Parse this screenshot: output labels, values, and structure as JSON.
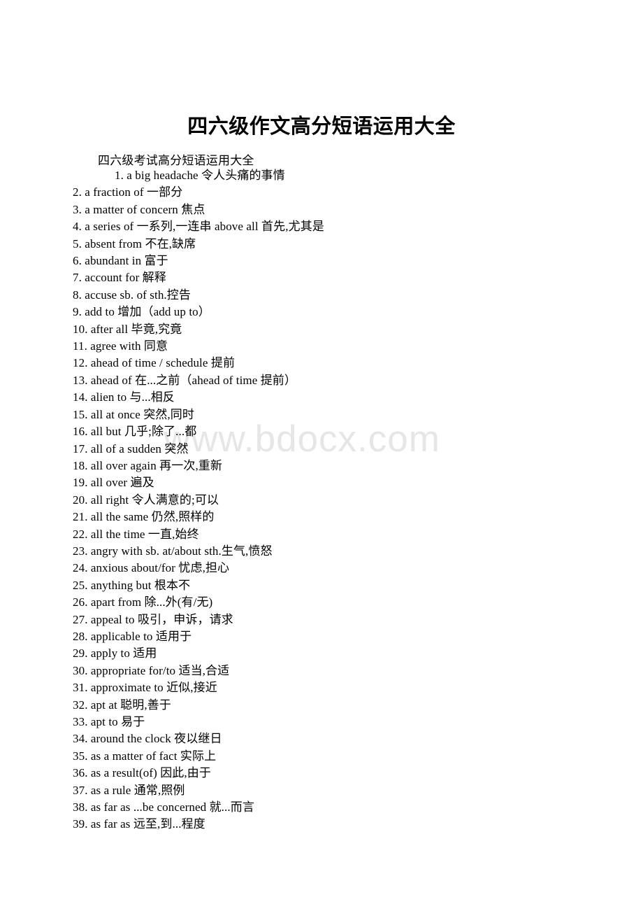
{
  "document": {
    "title": "四六级作文高分短语运用大全",
    "subtitle": "四六级考试高分短语运用大全",
    "watermark": "www.bdocx.com"
  },
  "phrases": [
    {
      "n": "1.",
      "text": "1. a big headache 令人头痛的事情",
      "indented": true
    },
    {
      "n": "2.",
      "text": "2. a fraction of 一部分",
      "indented": false
    },
    {
      "n": "3.",
      "text": "3. a matter of concern 焦点",
      "indented": false
    },
    {
      "n": "4.",
      "text": "4. a series of 一系列,一连串 above all 首先,尤其是",
      "indented": false
    },
    {
      "n": "5.",
      "text": "5. absent from 不在,缺席",
      "indented": false
    },
    {
      "n": "6.",
      "text": "6. abundant in 富于",
      "indented": false
    },
    {
      "n": "7.",
      "text": "7. account for 解释",
      "indented": false
    },
    {
      "n": "8.",
      "text": "8. accuse sb. of sth.控告",
      "indented": false
    },
    {
      "n": "9.",
      "text": "9. add to 增加（add up to）",
      "indented": false
    },
    {
      "n": "10.",
      "text": "10. after all 毕竟,究竟",
      "indented": false
    },
    {
      "n": "11.",
      "text": "11. agree with 同意",
      "indented": false
    },
    {
      "n": "12.",
      "text": "12. ahead of time / schedule 提前",
      "indented": false
    },
    {
      "n": "13.",
      "text": "13. ahead of 在...之前（ahead of time 提前）",
      "indented": false
    },
    {
      "n": "14.",
      "text": "14. alien to 与...相反",
      "indented": false
    },
    {
      "n": "15.",
      "text": "15. all at once 突然,同时",
      "indented": false
    },
    {
      "n": "16.",
      "text": "16. all but 几乎;除了...都",
      "indented": false
    },
    {
      "n": "17.",
      "text": "17. all of a sudden 突然",
      "indented": false
    },
    {
      "n": "18.",
      "text": "18. all over again 再一次,重新",
      "indented": false
    },
    {
      "n": "19.",
      "text": "19. all over 遍及",
      "indented": false
    },
    {
      "n": "20.",
      "text": "20. all right 令人满意的;可以",
      "indented": false
    },
    {
      "n": "21.",
      "text": "21. all the same 仍然,照样的",
      "indented": false
    },
    {
      "n": "22.",
      "text": "22. all the time 一直,始终",
      "indented": false
    },
    {
      "n": "23.",
      "text": "23. angry with sb. at/about sth.生气,愤怒",
      "indented": false
    },
    {
      "n": "24.",
      "text": "24. anxious about/for 忧虑,担心",
      "indented": false
    },
    {
      "n": "25.",
      "text": "25. anything but 根本不",
      "indented": false
    },
    {
      "n": "26.",
      "text": "26. apart from 除...外(有/无)",
      "indented": false
    },
    {
      "n": "27.",
      "text": "27. appeal to 吸引，申诉，请求",
      "indented": false
    },
    {
      "n": "28.",
      "text": "28. applicable to 适用于",
      "indented": false
    },
    {
      "n": "29.",
      "text": "29. apply to 适用",
      "indented": false
    },
    {
      "n": "30.",
      "text": "30. appropriate for/to 适当,合适",
      "indented": false
    },
    {
      "n": "31.",
      "text": "31. approximate to 近似,接近",
      "indented": false
    },
    {
      "n": "32.",
      "text": "32. apt at 聪明,善于",
      "indented": false
    },
    {
      "n": "33.",
      "text": "33. apt to 易于",
      "indented": false
    },
    {
      "n": "34.",
      "text": "34. around the clock 夜以继日",
      "indented": false
    },
    {
      "n": "35.",
      "text": "35. as a matter of fact 实际上",
      "indented": false
    },
    {
      "n": "36.",
      "text": "36. as a result(of) 因此,由于",
      "indented": false
    },
    {
      "n": "37.",
      "text": "37. as a rule 通常,照例",
      "indented": false
    },
    {
      "n": "38.",
      "text": "38. as far as ...be concerned 就...而言",
      "indented": false
    },
    {
      "n": "39.",
      "text": "39. as far as 远至,到...程度",
      "indented": false
    }
  ]
}
